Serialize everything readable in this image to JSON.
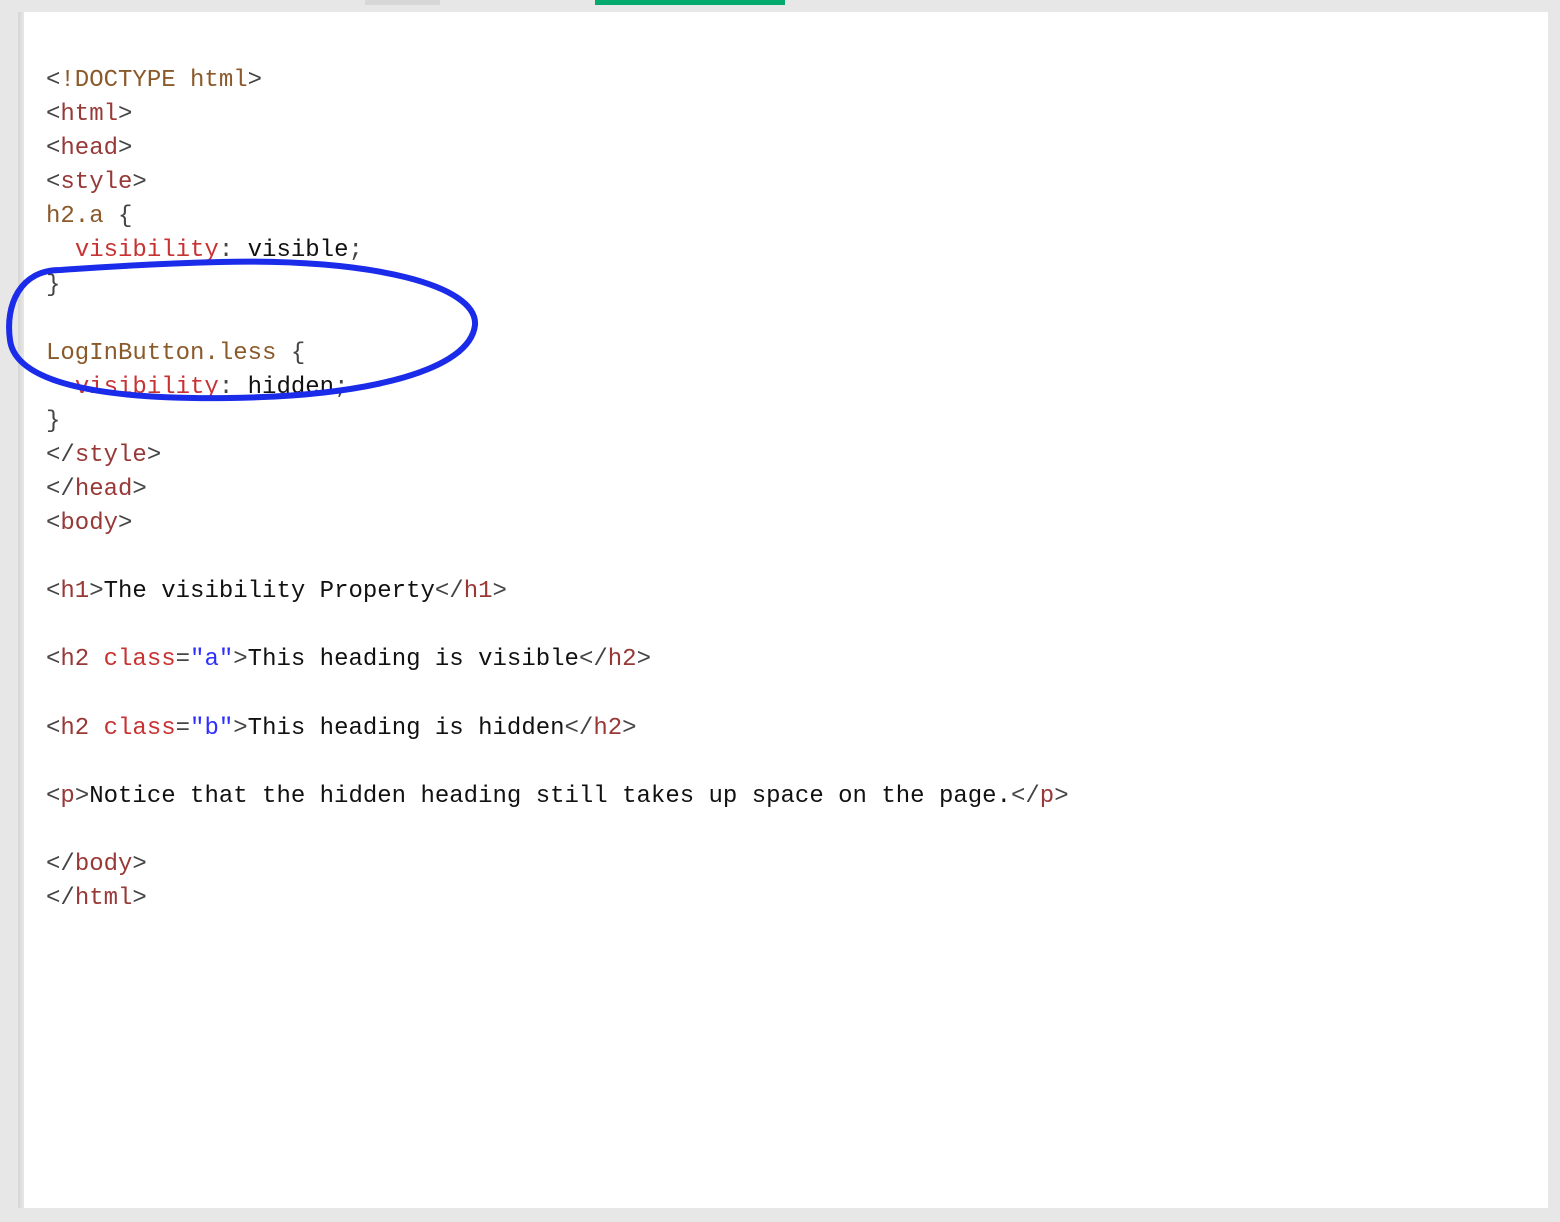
{
  "accent": {
    "green": "#04aa6d",
    "grey": "#d7d7d7"
  },
  "code": {
    "l01": {
      "dt1": "<",
      "dt2": "!DOCTYPE",
      "dt3": " ",
      "dt4": "html",
      "dt5": ">"
    },
    "l02": {
      "lt": "<",
      "tag": "html",
      "gt": ">"
    },
    "l03": {
      "lt": "<",
      "tag": "head",
      "gt": ">"
    },
    "l04": {
      "lt": "<",
      "tag": "style",
      "gt": ">"
    },
    "l05": {
      "sel": "h2.a",
      "sp": " ",
      "ob": "{"
    },
    "l06": {
      "ind": "  ",
      "prop": "visibility",
      "colon": ":",
      "sp": " ",
      "val": "visible",
      "semi": ";"
    },
    "l07": {
      "cb": "}"
    },
    "l08": {
      "blank": " "
    },
    "l09": {
      "sel": "LogInButton.less",
      "sp": " ",
      "ob": "{"
    },
    "l10": {
      "ind": "  ",
      "prop": "visibility",
      "colon": ":",
      "sp": " ",
      "val": "hidden",
      "semi": ";"
    },
    "l11": {
      "cb": "}"
    },
    "l12": {
      "lt": "</",
      "tag": "style",
      "gt": ">"
    },
    "l13": {
      "lt": "</",
      "tag": "head",
      "gt": ">"
    },
    "l14": {
      "lt": "<",
      "tag": "body",
      "gt": ">"
    },
    "l15": {
      "blank": " "
    },
    "l16": {
      "open_lt": "<",
      "open_tag": "h1",
      "open_gt": ">",
      "text": "The visibility Property",
      "close_lt": "</",
      "close_tag": "h1",
      "close_gt": ">"
    },
    "l17": {
      "blank": " "
    },
    "l18": {
      "open_lt": "<",
      "open_tag": "h2",
      "sp1": " ",
      "attr": "class",
      "eq": "=",
      "q1": "\"",
      "aval": "a",
      "q2": "\"",
      "open_gt": ">",
      "text": "This heading is visible",
      "close_lt": "</",
      "close_tag": "h2",
      "close_gt": ">"
    },
    "l19": {
      "blank": " "
    },
    "l20": {
      "open_lt": "<",
      "open_tag": "h2",
      "sp1": " ",
      "attr": "class",
      "eq": "=",
      "q1": "\"",
      "aval": "b",
      "q2": "\"",
      "open_gt": ">",
      "text": "This heading is hidden",
      "close_lt": "</",
      "close_tag": "h2",
      "close_gt": ">"
    },
    "l21": {
      "blank": " "
    },
    "l22": {
      "open_lt": "<",
      "open_tag": "p",
      "open_gt": ">",
      "text": "Notice that the hidden heading still takes up space on the page.",
      "close_lt": "</",
      "close_tag": "p",
      "close_gt": ">"
    },
    "l23": {
      "blank": " "
    },
    "l24": {
      "lt": "</",
      "tag": "body",
      "gt": ">"
    },
    "l25": {
      "lt": "</",
      "tag": "html",
      "gt": ">"
    }
  },
  "annotation": {
    "stroke": "#1a2bea",
    "stroke_width": 6
  }
}
